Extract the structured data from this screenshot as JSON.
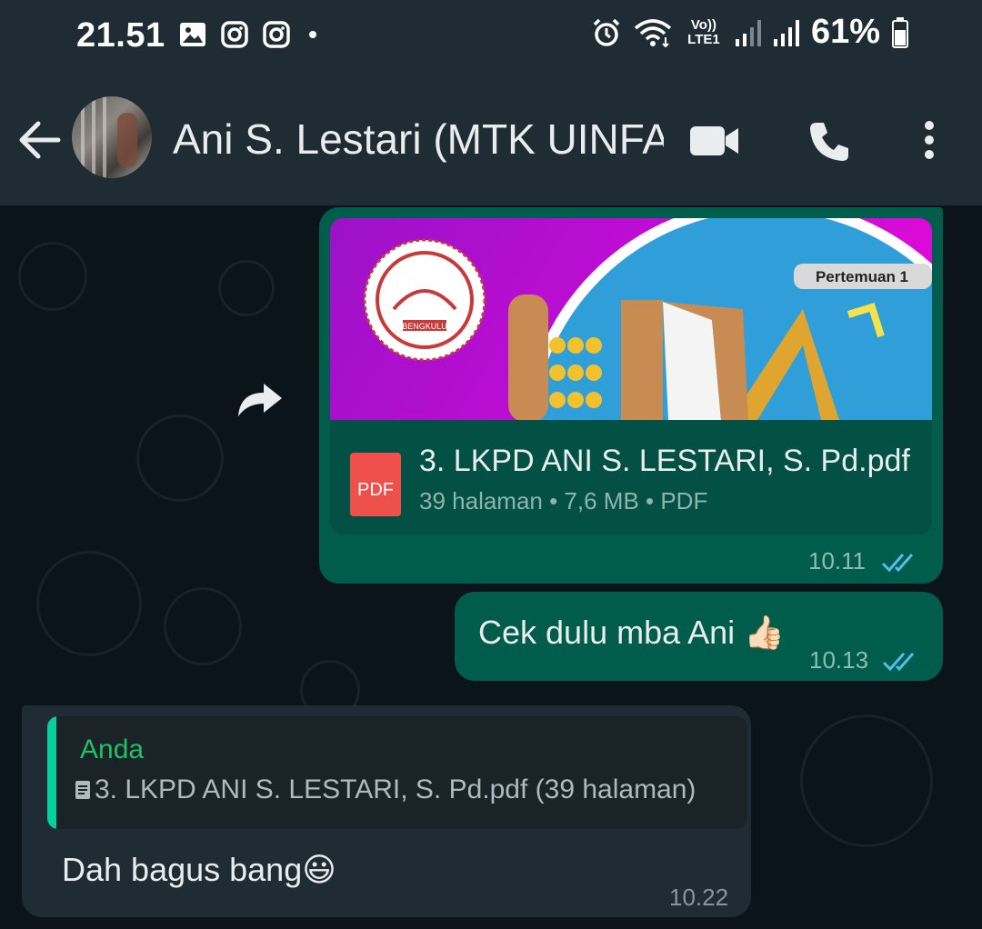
{
  "status_bar": {
    "time": "21.51",
    "network": "Vo)) LTE1",
    "battery": "61%"
  },
  "header": {
    "contact_name": "Ani S. Lestari (MTK UINFAS",
    "icons": [
      "back-arrow-icon",
      "video-call-icon",
      "phone-icon",
      "more-options-icon"
    ]
  },
  "messages": {
    "doc": {
      "preview_badge": "Pertemuan 1",
      "logo_text": "BENGKULU",
      "file_name": "3. LKPD ANI S. LESTARI, S. Pd.pdf",
      "file_icon_label": "PDF",
      "meta": "39 halaman • 7,6 MB • PDF",
      "time": "10.11"
    },
    "text_out": {
      "text": "Cek dulu mba Ani 👍🏻",
      "time": "10.13"
    },
    "reply_in": {
      "quote_author": "Anda",
      "quote_text": "3. LKPD ANI S. LESTARI, S. Pd.pdf (39 halaman)",
      "text": "Dah bagus bang😃",
      "time": "10.22"
    }
  },
  "colors": {
    "background": "#0b141a",
    "header": "#1f2c34",
    "outgoing_bubble": "#005c4b",
    "incoming_bubble": "#202c33",
    "read_ticks": "#53bdeb",
    "quote_accent": "#06cf9c"
  }
}
